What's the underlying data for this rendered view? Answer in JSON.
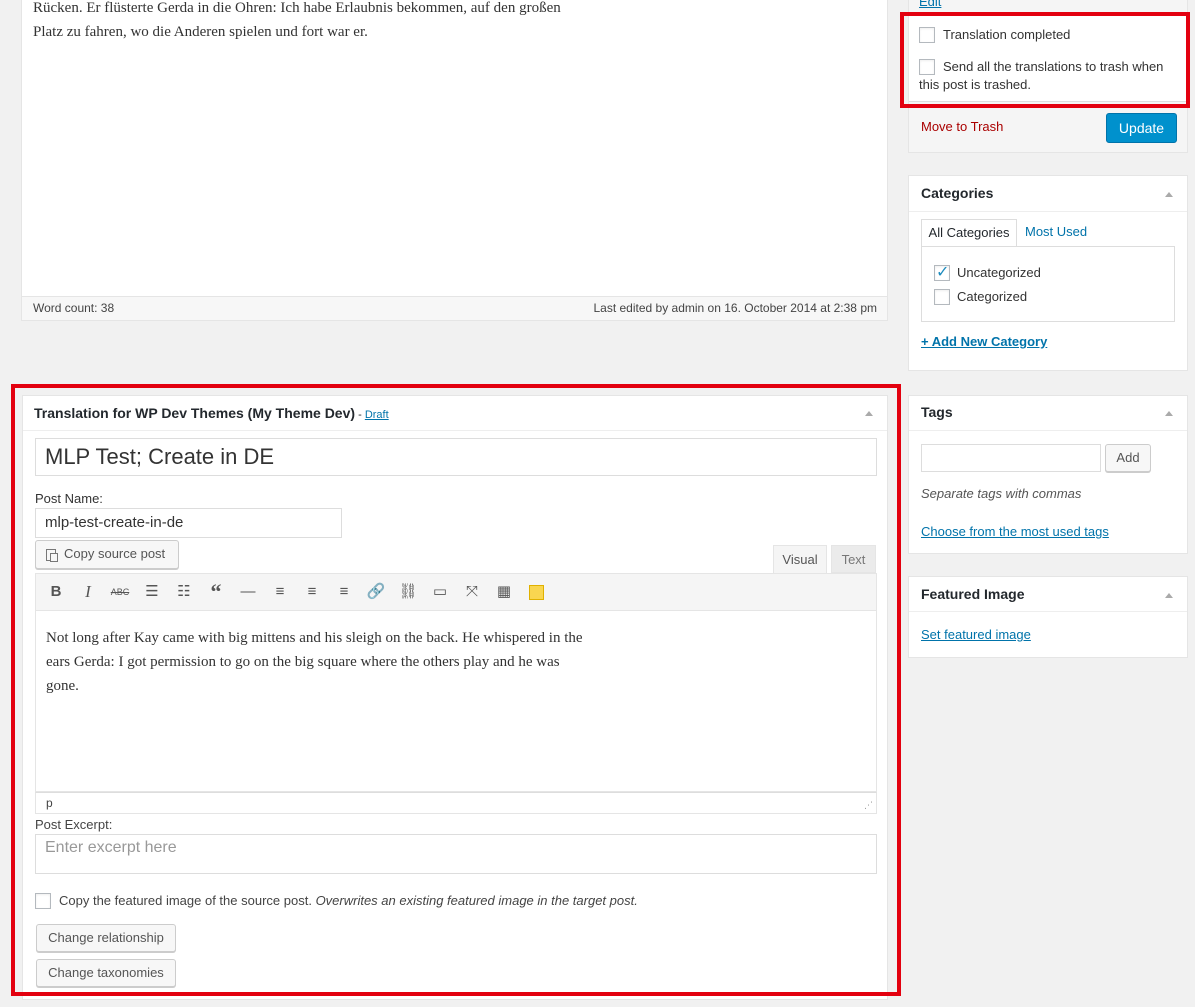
{
  "top_editor": {
    "text_line1": "Rücken. Er flüsterte Gerda in die Ohren: Ich habe Erlaubnis bekommen, auf den großen",
    "text_line2": "Platz zu fahren, wo die Anderen spielen und fort war er.",
    "word_count": "Word count: 38",
    "last_edited": "Last edited by admin on 16. October 2014 at 2:38 pm"
  },
  "publish": {
    "edit_link": "Edit",
    "translation_completed": "Translation completed",
    "send_to_trash_line1": "Send all the translations to trash when",
    "send_to_trash_line2": "this post is trashed.",
    "move_to_trash": "Move to Trash",
    "update": "Update"
  },
  "categories": {
    "title": "Categories",
    "tab_all": "All Categories",
    "tab_most_used": "Most Used",
    "items": [
      {
        "label": "Uncategorized",
        "checked": true
      },
      {
        "label": "Categorized",
        "checked": false
      }
    ],
    "add_new": "+ Add New Category"
  },
  "tags": {
    "title": "Tags",
    "add_button": "Add",
    "hint": "Separate tags with commas",
    "choose_link": "Choose from the most used tags"
  },
  "featured_image": {
    "title": "Featured Image",
    "set_link": "Set featured image"
  },
  "translation": {
    "title": "Translation for WP Dev Themes (My Theme Dev)",
    "title_sep": " - ",
    "status_link": "Draft",
    "post_title": "MLP Test; Create in DE",
    "post_name_label": "Post Name:",
    "post_name_value": "mlp-test-create-in-de",
    "copy_source_button": "Copy source post",
    "tab_visual": "Visual",
    "tab_text": "Text",
    "toolbar_icons": [
      "bold-icon",
      "italic-icon",
      "strikethrough-icon",
      "bullet-list-icon",
      "numbered-list-icon",
      "blockquote-icon",
      "horizontal-rule-icon",
      "align-left-icon",
      "align-center-icon",
      "align-right-icon",
      "link-icon",
      "unlink-icon",
      "read-more-icon",
      "fullscreen-icon",
      "toolbar-toggle-icon",
      "sticky-note-icon"
    ],
    "editor_line1": "Not long after Kay came with big mittens and his sleigh on the back. He whispered in the",
    "editor_line2": "ears Gerda: I got permission to go on the big square where the others play and he was",
    "editor_line3": "gone.",
    "path": "p",
    "excerpt_label": "Post Excerpt:",
    "excerpt_placeholder": "Enter excerpt here",
    "copy_featured_text": "Copy the featured image of the source post.",
    "copy_featured_note": "Overwrites an existing featured image in the target post.",
    "change_relationship": "Change relationship",
    "change_taxonomies": "Change taxonomies"
  },
  "colors": {
    "highlight_border": "#e3000f",
    "primary_button": "#0091cd",
    "link": "#0073aa",
    "trash": "#aa0000"
  }
}
